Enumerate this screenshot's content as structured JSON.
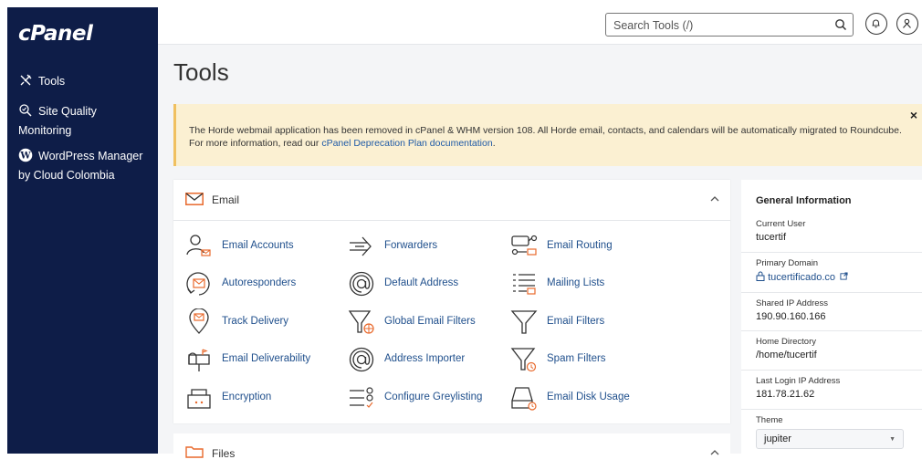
{
  "sidebar": {
    "logo": "cPanel",
    "items": [
      {
        "label": "Tools",
        "icon": "tools-icon"
      },
      {
        "label": "Site Quality",
        "label2": "Monitoring",
        "icon": "site-quality-icon"
      },
      {
        "label": "WordPress Manager",
        "label2": "by Cloud Colombia",
        "icon": "wordpress-icon"
      }
    ]
  },
  "header": {
    "search_placeholder": "Search Tools (/)",
    "icons": [
      "search-icon",
      "bell-icon",
      "user-icon"
    ]
  },
  "page": {
    "title": "Tools"
  },
  "notice": {
    "line1": "The Horde webmail application has been removed in cPanel & WHM version 108. All Horde email, contacts, and calendars will be automatically migrated to Roundcube.",
    "line2_prefix": "For more information, read our ",
    "line2_link": "cPanel Deprecation Plan documentation",
    "line2_suffix": ".",
    "close": "×"
  },
  "email_panel": {
    "title": "Email",
    "tools": [
      {
        "label": "Email Accounts",
        "icon": "email-accounts-icon"
      },
      {
        "label": "Forwarders",
        "icon": "forwarders-icon"
      },
      {
        "label": "Email Routing",
        "icon": "email-routing-icon"
      },
      {
        "label": "Autoresponders",
        "icon": "autoresponders-icon"
      },
      {
        "label": "Default Address",
        "icon": "default-address-icon"
      },
      {
        "label": "Mailing Lists",
        "icon": "mailing-lists-icon"
      },
      {
        "label": "Track Delivery",
        "icon": "track-delivery-icon"
      },
      {
        "label": "Global Email Filters",
        "icon": "global-filters-icon"
      },
      {
        "label": "Email Filters",
        "icon": "email-filters-icon"
      },
      {
        "label": "Email Deliverability",
        "icon": "deliverability-icon"
      },
      {
        "label": "Address Importer",
        "icon": "address-importer-icon"
      },
      {
        "label": "Spam Filters",
        "icon": "spam-filters-icon"
      },
      {
        "label": "Encryption",
        "icon": "encryption-icon"
      },
      {
        "label": "Configure Greylisting",
        "icon": "greylisting-icon"
      },
      {
        "label": "Email Disk Usage",
        "icon": "disk-usage-icon"
      }
    ]
  },
  "files_panel": {
    "title": "Files"
  },
  "general_info": {
    "title": "General Information",
    "current_user_label": "Current User",
    "current_user": "tucertif",
    "primary_domain_label": "Primary Domain",
    "primary_domain": "tucertificado.co",
    "shared_ip_label": "Shared IP Address",
    "shared_ip": "190.90.160.166",
    "home_dir_label": "Home Directory",
    "home_dir": "/home/tucertif",
    "last_login_label": "Last Login IP Address",
    "last_login": "181.78.21.62",
    "theme_label": "Theme",
    "theme": "jupiter"
  },
  "colors": {
    "sidebar": "#0e1d48",
    "accent_orange": "#e8692c",
    "link": "#1f4f8c",
    "notice_bg": "#fbf0d2"
  }
}
